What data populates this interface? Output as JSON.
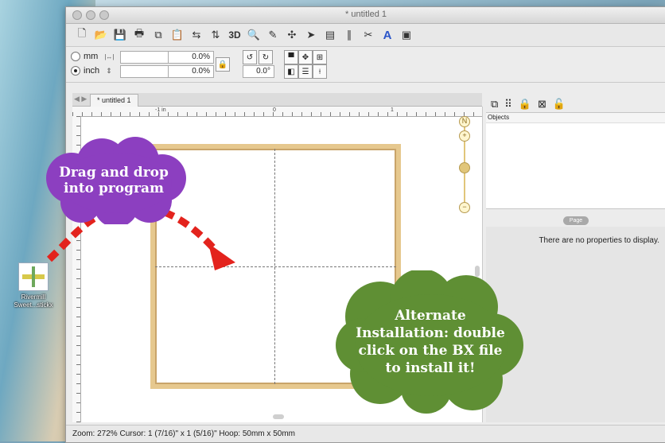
{
  "window": {
    "title": "* untitled 1"
  },
  "props": {
    "unit_mm": "mm",
    "unit_inch": "inch",
    "field_w_pct": "0.0%",
    "field_h_pct": "0.0%",
    "rotation": "0.0°"
  },
  "document_tab": "* untitled 1",
  "ruler": {
    "label_neg1": "-1 in",
    "label_0": "0",
    "label_1": "1"
  },
  "objects_panel": {
    "header": "Objects"
  },
  "page_panel": {
    "tab": "Page",
    "empty_text": "There are no properties to display."
  },
  "status": {
    "text": "Zoom: 272%  Cursor: 1 (7/16)\" x 1 (5/16)\"    Hoop:  50mm x  50mm"
  },
  "desktop_icon": {
    "label_line1": "Rivermill",
    "label_line2": "Sweet...stickx"
  },
  "callouts": {
    "drag": "Drag and drop\ninto program",
    "alternate": "Alternate\nInstallation: double\nclick on the BX file\nto install it!"
  },
  "colors": {
    "purple_cloud": "#8c3fc0",
    "green_cloud": "#5f8f34",
    "arrow": "#e3231d",
    "hoop": "#e6c88e"
  }
}
